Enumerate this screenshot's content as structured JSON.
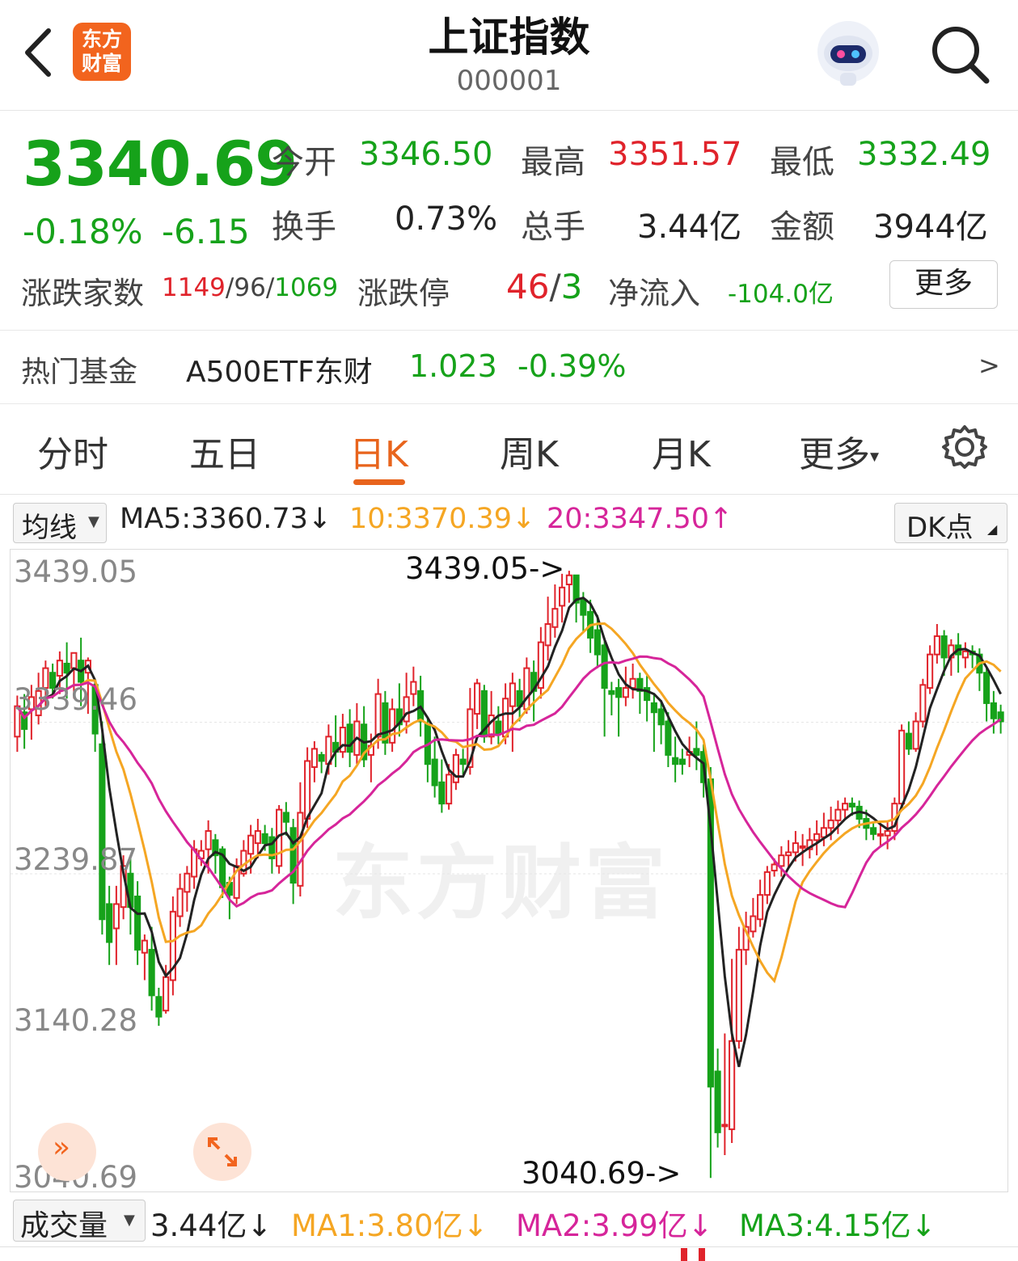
{
  "header": {
    "title": "上证指数",
    "code": "000001",
    "logo_line1": "东方",
    "logo_line2": "财富"
  },
  "quote": {
    "price": "3340.69",
    "change_pct": "-0.18%",
    "change": "-6.15",
    "open_label": "今开",
    "open": "3346.50",
    "high_label": "最高",
    "high": "3351.57",
    "low_label": "最低",
    "low": "3332.49",
    "turnover_label": "换手",
    "turnover": "0.73%",
    "volume_label": "总手",
    "volume": "3.44亿",
    "amount_label": "金额",
    "amount": "3944亿",
    "breadth_label": "涨跌家数",
    "breadth_up": "1149",
    "breadth_flat": "96",
    "breadth_down": "1069",
    "limit_label": "涨跌停",
    "limit_up": "46",
    "limit_down": "3",
    "netflow_label": "净流入",
    "netflow": "-104.0亿",
    "more_button": "更多"
  },
  "fund": {
    "label": "热门基金",
    "name": "A500ETF东财",
    "price": "1.023",
    "change": "-0.39%",
    "arrow": ">"
  },
  "tabs": [
    {
      "label": "分时",
      "active": false
    },
    {
      "label": "五日",
      "active": false
    },
    {
      "label": "日K",
      "active": true
    },
    {
      "label": "周K",
      "active": false
    },
    {
      "label": "月K",
      "active": false
    },
    {
      "label": "更多",
      "active": false
    }
  ],
  "ma_bar": {
    "selector": "均线",
    "ma5": "MA5:3360.73↓",
    "ma10": "10:3370.39↓",
    "ma20": "20:3347.50↑",
    "dk_button": "DK点"
  },
  "volume_bar": {
    "selector": "成交量",
    "value": "3.44亿↓",
    "ma1": "MA1:3.80亿↓",
    "ma2": "MA2:3.99亿↓",
    "ma3": "MA3:4.15亿↓"
  },
  "colors": {
    "up": "#e0232b",
    "down": "#16a21a",
    "accent": "#e8641d",
    "ma5": "#222222",
    "ma10": "#f5a623",
    "ma20": "#d6259a"
  },
  "chart_data": {
    "type": "candlestick",
    "y_ticks": [
      "3439.05",
      "3339.46",
      "3239.87",
      "3140.28",
      "3040.69"
    ],
    "ylim": [
      3040.69,
      3439.05
    ],
    "max_marker": "3439.05->",
    "min_marker": "3040.69->",
    "watermark": "东方财富",
    "candles": [
      [
        3330,
        3350,
        3320,
        3357
      ],
      [
        3346,
        3335,
        3322,
        3358
      ],
      [
        3348,
        3356,
        3328,
        3364
      ],
      [
        3344,
        3360,
        3338,
        3372
      ],
      [
        3362,
        3375,
        3350,
        3380
      ],
      [
        3372,
        3362,
        3355,
        3378
      ],
      [
        3370,
        3380,
        3358,
        3386
      ],
      [
        3378,
        3372,
        3355,
        3392
      ],
      [
        3375,
        3385,
        3355,
        3382
      ],
      [
        3380,
        3366,
        3350,
        3395
      ],
      [
        3372,
        3380,
        3345,
        3382
      ],
      [
        3364,
        3332,
        3320,
        3368
      ],
      [
        3325,
        3210,
        3200,
        3340
      ],
      [
        3220,
        3195,
        3180,
        3232
      ],
      [
        3204,
        3220,
        3180,
        3232
      ],
      [
        3218,
        3245,
        3210,
        3252
      ],
      [
        3240,
        3218,
        3200,
        3250
      ],
      [
        3225,
        3190,
        3180,
        3235
      ],
      [
        3188,
        3196,
        3170,
        3200
      ],
      [
        3190,
        3160,
        3150,
        3205
      ],
      [
        3159,
        3146,
        3140,
        3165
      ],
      [
        3150,
        3172,
        3148,
        3180
      ],
      [
        3170,
        3215,
        3160,
        3225
      ],
      [
        3212,
        3230,
        3205,
        3240
      ],
      [
        3228,
        3240,
        3215,
        3245
      ],
      [
        3238,
        3256,
        3230,
        3262
      ],
      [
        3250,
        3255,
        3245,
        3262
      ],
      [
        3256,
        3268,
        3240,
        3275
      ],
      [
        3262,
        3252,
        3240,
        3266
      ],
      [
        3256,
        3231,
        3224,
        3258
      ],
      [
        3234,
        3226,
        3210,
        3238
      ],
      [
        3224,
        3245,
        3220,
        3250
      ],
      [
        3240,
        3255,
        3238,
        3262
      ],
      [
        3253,
        3265,
        3240,
        3272
      ],
      [
        3260,
        3268,
        3250,
        3276
      ],
      [
        3266,
        3260,
        3255,
        3272
      ],
      [
        3264,
        3250,
        3240,
        3270
      ],
      [
        3245,
        3282,
        3240,
        3285
      ],
      [
        3280,
        3274,
        3265,
        3287
      ],
      [
        3270,
        3234,
        3220,
        3276
      ],
      [
        3232,
        3280,
        3225,
        3300
      ],
      [
        3276,
        3314,
        3270,
        3323
      ],
      [
        3310,
        3322,
        3300,
        3327
      ],
      [
        3318,
        3314,
        3306,
        3320
      ],
      [
        3312,
        3330,
        3305,
        3338
      ],
      [
        3326,
        3320,
        3310,
        3344
      ],
      [
        3320,
        3336,
        3316,
        3345
      ],
      [
        3338,
        3320,
        3310,
        3348
      ],
      [
        3318,
        3340,
        3312,
        3352
      ],
      [
        3338,
        3315,
        3310,
        3350
      ],
      [
        3318,
        3324,
        3300,
        3332
      ],
      [
        3330,
        3358,
        3322,
        3368
      ],
      [
        3352,
        3326,
        3318,
        3360
      ],
      [
        3326,
        3348,
        3320,
        3355
      ],
      [
        3348,
        3338,
        3330,
        3365
      ],
      [
        3340,
        3356,
        3332,
        3372
      ],
      [
        3358,
        3366,
        3350,
        3376
      ],
      [
        3360,
        3340,
        3330,
        3370
      ],
      [
        3338,
        3312,
        3300,
        3342
      ],
      [
        3315,
        3298,
        3290,
        3330
      ],
      [
        3300,
        3286,
        3280,
        3315
      ],
      [
        3286,
        3305,
        3282,
        3312
      ],
      [
        3300,
        3318,
        3295,
        3322
      ],
      [
        3315,
        3312,
        3305,
        3322
      ],
      [
        3310,
        3348,
        3305,
        3362
      ],
      [
        3345,
        3365,
        3335,
        3368
      ],
      [
        3360,
        3330,
        3326,
        3364
      ],
      [
        3330,
        3344,
        3325,
        3360
      ],
      [
        3340,
        3332,
        3325,
        3350
      ],
      [
        3330,
        3355,
        3325,
        3365
      ],
      [
        3350,
        3365,
        3320,
        3372
      ],
      [
        3360,
        3350,
        3340,
        3368
      ],
      [
        3348,
        3375,
        3345,
        3382
      ],
      [
        3372,
        3360,
        3340,
        3380
      ],
      [
        3362,
        3392,
        3355,
        3402
      ],
      [
        3390,
        3404,
        3380,
        3422
      ],
      [
        3402,
        3414,
        3395,
        3430
      ],
      [
        3416,
        3428,
        3405,
        3437
      ],
      [
        3430,
        3436,
        3418,
        3439
      ],
      [
        3436,
        3418,
        3405,
        3432
      ],
      [
        3420,
        3410,
        3398,
        3425
      ],
      [
        3412,
        3395,
        3385,
        3420
      ],
      [
        3400,
        3384,
        3375,
        3410
      ],
      [
        3390,
        3362,
        3330,
        3395
      ],
      [
        3360,
        3358,
        3344,
        3366
      ],
      [
        3362,
        3356,
        3330,
        3368
      ],
      [
        3356,
        3362,
        3350,
        3376
      ],
      [
        3362,
        3368,
        3355,
        3378
      ],
      [
        3368,
        3360,
        3345,
        3372
      ],
      [
        3362,
        3354,
        3340,
        3370
      ],
      [
        3352,
        3346,
        3320,
        3358
      ],
      [
        3348,
        3338,
        3325,
        3354
      ],
      [
        3340,
        3318,
        3310,
        3346
      ],
      [
        3316,
        3312,
        3300,
        3330
      ],
      [
        3315,
        3312,
        3305,
        3322
      ],
      [
        3318,
        3320,
        3310,
        3330
      ],
      [
        3322,
        3318,
        3308,
        3340
      ],
      [
        3320,
        3300,
        3290,
        3325
      ],
      [
        3302,
        3100,
        3040,
        3310
      ],
      [
        3110,
        3070,
        3060,
        3125
      ],
      [
        3075,
        3075,
        3055,
        3135
      ],
      [
        3072,
        3130,
        3063,
        3184
      ],
      [
        3130,
        3190,
        3125,
        3205
      ],
      [
        3190,
        3205,
        3180,
        3215
      ],
      [
        3202,
        3212,
        3198,
        3224
      ],
      [
        3210,
        3226,
        3205,
        3236
      ],
      [
        3226,
        3241,
        3220,
        3245
      ],
      [
        3242,
        3246,
        3238,
        3250
      ],
      [
        3245,
        3252,
        3238,
        3258
      ],
      [
        3252,
        3254,
        3243,
        3262
      ],
      [
        3254,
        3260,
        3248,
        3268
      ],
      [
        3258,
        3258,
        3245,
        3266
      ],
      [
        3256,
        3262,
        3250,
        3270
      ],
      [
        3262,
        3266,
        3252,
        3275
      ],
      [
        3264,
        3270,
        3258,
        3280
      ],
      [
        3270,
        3275,
        3262,
        3284
      ],
      [
        3275,
        3282,
        3266,
        3288
      ],
      [
        3282,
        3286,
        3276,
        3290
      ],
      [
        3286,
        3284,
        3278,
        3290
      ],
      [
        3284,
        3276,
        3270,
        3288
      ],
      [
        3276,
        3270,
        3262,
        3282
      ],
      [
        3270,
        3266,
        3262,
        3274
      ],
      [
        3266,
        3266,
        3258,
        3272
      ],
      [
        3265,
        3268,
        3256,
        3274
      ],
      [
        3268,
        3286,
        3262,
        3290
      ],
      [
        3286,
        3334,
        3282,
        3338
      ],
      [
        3332,
        3322,
        3318,
        3340
      ],
      [
        3322,
        3340,
        3320,
        3346
      ],
      [
        3340,
        3364,
        3336,
        3368
      ],
      [
        3362,
        3384,
        3358,
        3390
      ],
      [
        3384,
        3396,
        3378,
        3404
      ],
      [
        3396,
        3382,
        3370,
        3400
      ],
      [
        3382,
        3390,
        3370,
        3394
      ],
      [
        3390,
        3384,
        3372,
        3398
      ],
      [
        3382,
        3386,
        3375,
        3392
      ],
      [
        3386,
        3384,
        3375,
        3390
      ],
      [
        3384,
        3372,
        3360,
        3388
      ],
      [
        3372,
        3352,
        3340,
        3375
      ],
      [
        3352,
        3342,
        3332,
        3360
      ],
      [
        3346,
        3340,
        3332,
        3351
      ]
    ]
  }
}
